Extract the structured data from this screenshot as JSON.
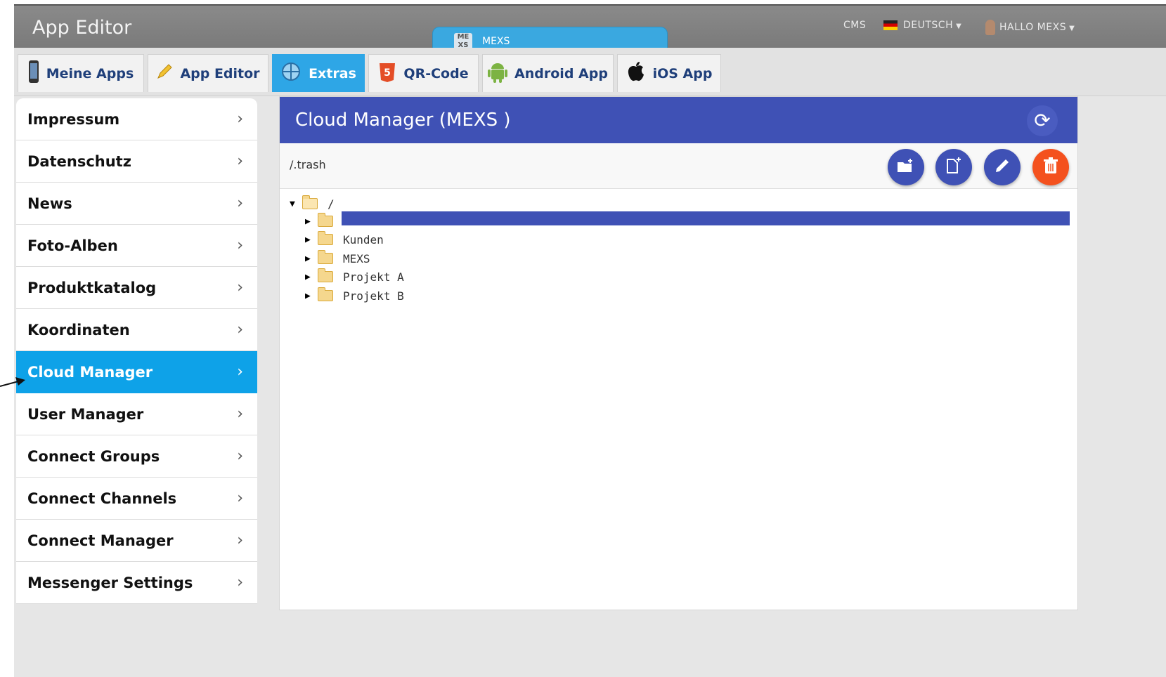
{
  "app": {
    "title": "App Editor"
  },
  "center_tab": {
    "label": "MEXS",
    "logo_text": "ME XS"
  },
  "top_right": {
    "cms": "CMS",
    "language": "DEUTSCH",
    "greeting": "HALLO MEXS"
  },
  "tabs": [
    {
      "label": "Meine Apps",
      "icon": "phone-icon"
    },
    {
      "label": "App Editor",
      "icon": "pencil-icon"
    },
    {
      "label": "Extras",
      "icon": "globe-icon",
      "active": true
    },
    {
      "label": "QR-Code",
      "icon": "html5-icon"
    },
    {
      "label": "Android App",
      "icon": "android-icon"
    },
    {
      "label": "iOS App",
      "icon": "apple-icon"
    }
  ],
  "sidebar": {
    "items": [
      {
        "label": "Impressum"
      },
      {
        "label": "Datenschutz"
      },
      {
        "label": "News"
      },
      {
        "label": "Foto-Alben"
      },
      {
        "label": "Produktkatalog"
      },
      {
        "label": "Koordinaten"
      },
      {
        "label": "Cloud Manager",
        "active": true
      },
      {
        "label": "User Manager"
      },
      {
        "label": "Connect Groups"
      },
      {
        "label": "Connect Channels"
      },
      {
        "label": "Connect Manager"
      },
      {
        "label": "Messenger Settings"
      }
    ]
  },
  "main": {
    "title": "Cloud Manager (MEXS )",
    "path": "/.trash",
    "actions": [
      "new-folder",
      "new-file",
      "edit",
      "delete"
    ],
    "tree": {
      "root": "/",
      "children": [
        "",
        "Kunden",
        "MEXS",
        "Projekt A",
        "Projekt B"
      ]
    }
  },
  "colors": {
    "accent": "#3f51b5",
    "active_tab": "#2ea6e6",
    "sidebar_active": "#0ea2e8",
    "delete": "#f4511e"
  }
}
